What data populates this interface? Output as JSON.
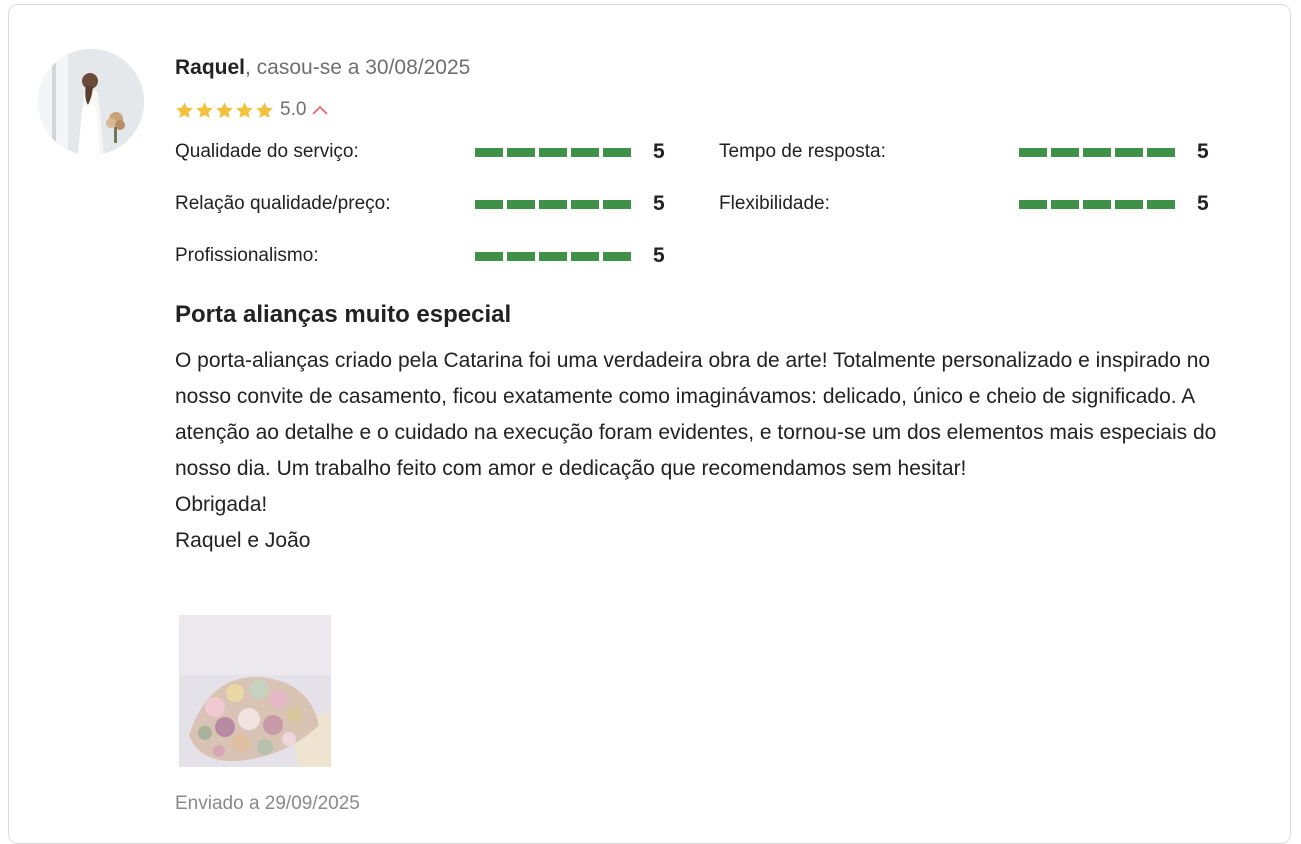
{
  "review": {
    "author": "Raquel",
    "married_text": ", casou-se a 30/08/2025",
    "overall_score": "5.0",
    "overall_stars": 5,
    "title": "Porta alianças muito especial",
    "body_lines": [
      "O porta-alianças criado pela Catarina foi uma verdadeira obra de arte! Totalmente personalizado e inspirado no nosso convite de casamento, ficou exatamente como imaginávamos: delicado, único e cheio de significado. A atenção ao detalhe e o cuidado na execução foram evidentes, e tornou-se um dos elementos mais especiais do nosso dia. Um trabalho feito com amor e dedicação que recomendamos sem hesitar!",
      "Obrigada!",
      "Raquel e João"
    ],
    "sent_text": "Enviado a 29/09/2025"
  },
  "ratings": [
    {
      "label": "Qualidade do serviço:",
      "value": "5",
      "level": 5
    },
    {
      "label": "Tempo de resposta:",
      "value": "5",
      "level": 5
    },
    {
      "label": "Relação qualidade/preço:",
      "value": "5",
      "level": 5
    },
    {
      "label": "Flexibilidade:",
      "value": "5",
      "level": 5
    },
    {
      "label": "Profissionalismo:",
      "value": "5",
      "level": 5
    }
  ],
  "colors": {
    "star": "#f2c23f",
    "bar": "#3f9147",
    "chevron": "#e8757e",
    "muted_text": "#6f6f6f"
  },
  "icons": {
    "star": "star-icon",
    "toggle": "chevron-up-icon"
  }
}
